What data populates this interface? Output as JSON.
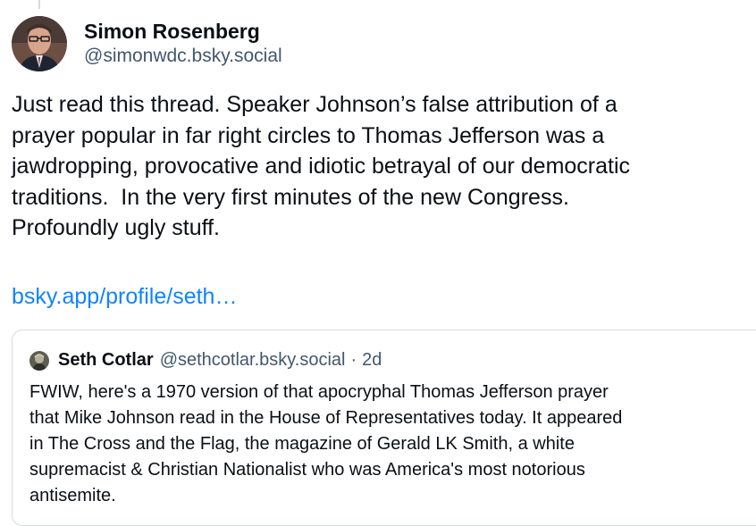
{
  "post": {
    "author": {
      "display_name": "Simon Rosenberg",
      "handle": "@simonwdc.bsky.social",
      "avatar_icon": "user-avatar-photo"
    },
    "text_lines": [
      "Just read this thread. Speaker Johnson’s false attribution of a",
      "prayer popular in far right circles to Thomas Jefferson was a",
      "jawdropping, provocative and idiotic betrayal of our democratic",
      "traditions.  In the very first minutes of the new Congress.",
      "Profoundly ugly stuff."
    ],
    "link_text": "bsky.app/profile/seth…"
  },
  "quote": {
    "author": {
      "display_name": "Seth Cotlar",
      "handle": "@sethcotlar.bsky.social",
      "avatar_icon": "user-avatar-photo"
    },
    "separator": "·",
    "time": "2d",
    "text_lines": [
      "FWIW, here's a 1970 version of that apocryphal Thomas Jefferson prayer",
      "that Mike Johnson read in the House of Representatives today. It appeared",
      "in The Cross and the Flag, the magazine of Gerald LK Smith, a white",
      "supremacist & Christian Nationalist who was America's most notorious",
      "antisemite."
    ]
  },
  "colors": {
    "text": "#0b0f14",
    "muted": "#42576c",
    "link": "#1083fe",
    "border": "#d4dbe2"
  }
}
